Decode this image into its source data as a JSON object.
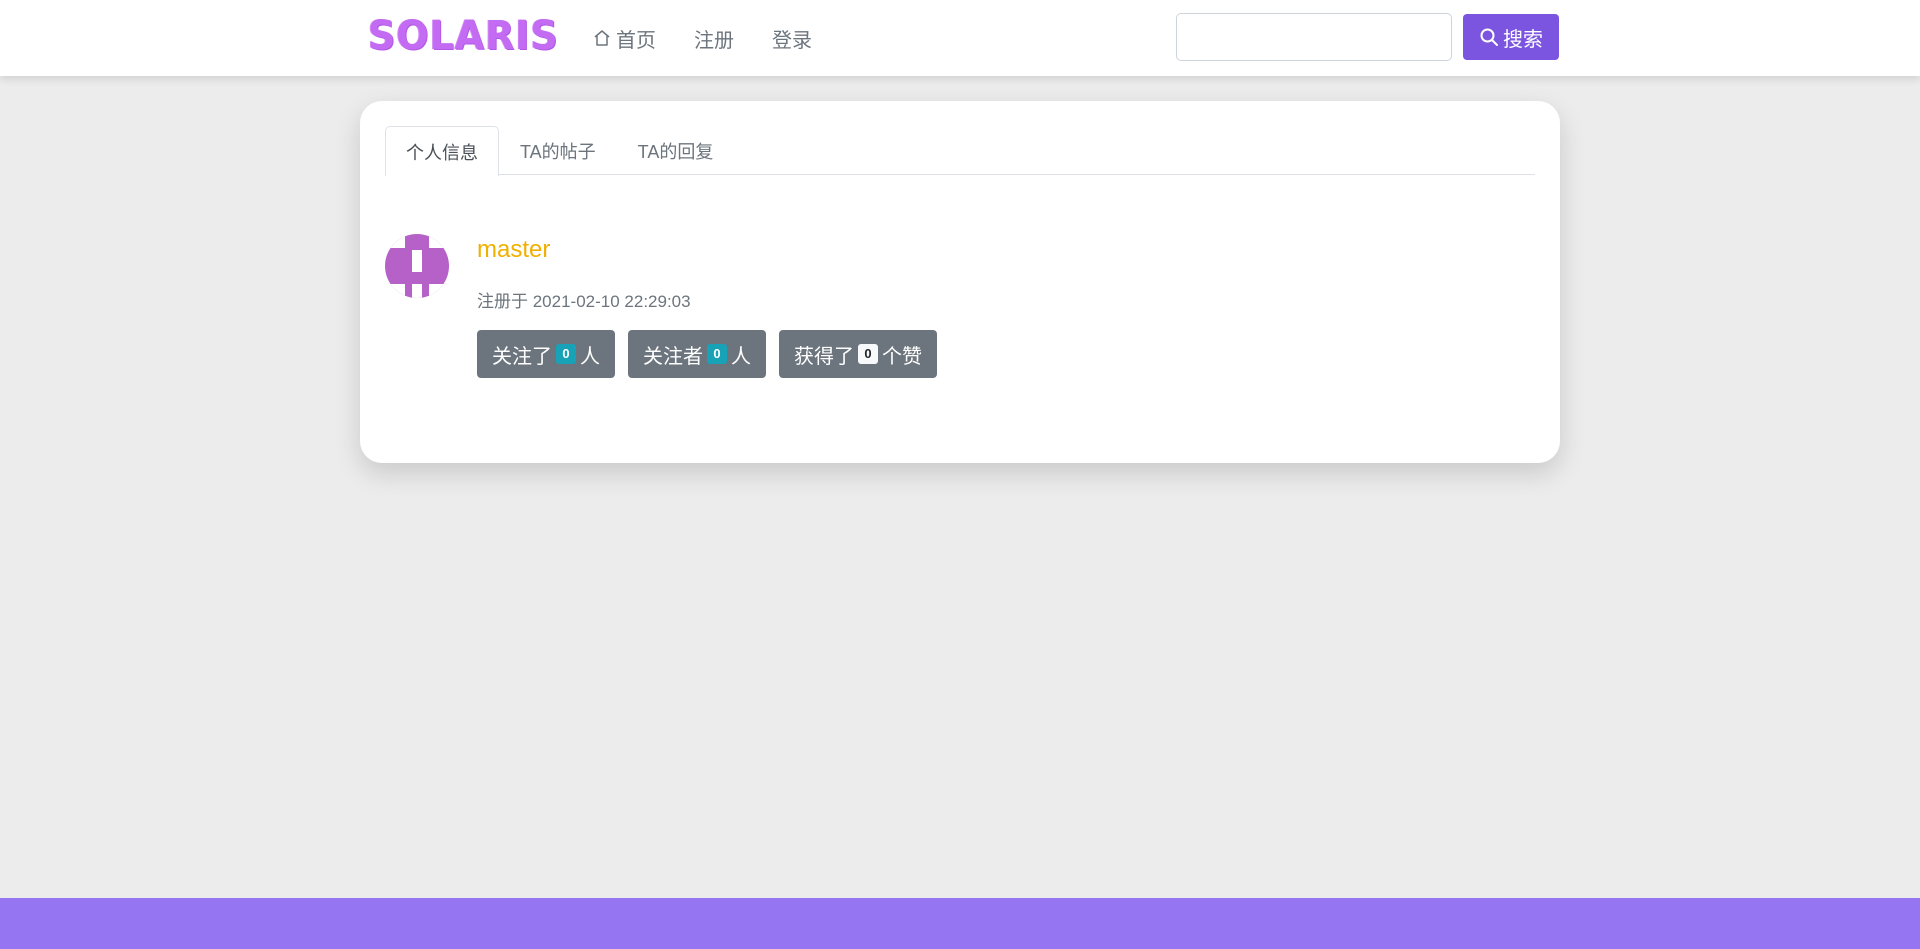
{
  "brand": {
    "name": "SOLARIS"
  },
  "nav": {
    "home": "首页",
    "register": "注册",
    "login": "登录"
  },
  "search": {
    "value": "",
    "placeholder": "",
    "button_label": "搜索"
  },
  "profile": {
    "tabs": [
      "个人信息",
      "TA的帖子",
      "TA的回复"
    ],
    "active_tab": "个人信息",
    "username": "master",
    "registered": "注册于 2021-02-10 22:29:03",
    "stats": {
      "following": {
        "prefix": "关注了",
        "count": "0",
        "suffix": "人"
      },
      "followers": {
        "prefix": "关注者",
        "count": "0",
        "suffix": "人"
      },
      "likes": {
        "prefix": "获得了",
        "count": "0",
        "suffix": "个赞"
      }
    }
  },
  "colors": {
    "brand": "#c36bf2",
    "accent": "#7b55e0",
    "footer": "#9575f2",
    "username": "#f0b000",
    "avatar": "#b561c7"
  }
}
